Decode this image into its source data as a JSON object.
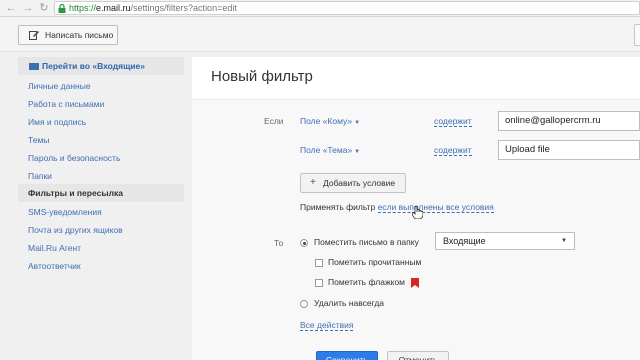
{
  "browser": {
    "url_scheme": "https://",
    "url_host": "e.mail.ru",
    "url_path": "/settings/filters?action=edit",
    "back_icon": "arrow-left-icon",
    "forward_icon": "arrow-right-icon",
    "reload_icon": "reload-icon",
    "lock_icon": "lock-icon"
  },
  "toolbar": {
    "compose_label": "Написать письмо",
    "compose_icon": "pencil-icon"
  },
  "sidebar": {
    "inbox_link": "Перейти во «Входящие»",
    "items": [
      {
        "label": "Личные данные"
      },
      {
        "label": "Работа с письмами"
      },
      {
        "label": "Имя и подпись"
      },
      {
        "label": "Темы"
      },
      {
        "label": "Пароль и безопасность"
      },
      {
        "label": "Папки"
      },
      {
        "label": "Фильтры и пересылка"
      },
      {
        "label": "SMS-уведомления"
      },
      {
        "label": "Почта из других ящиков"
      },
      {
        "label": "Mail.Ru Агент"
      },
      {
        "label": "Автоответчик"
      }
    ],
    "active_index": 6
  },
  "filter": {
    "title": "Новый фильтр",
    "if_label": "Если",
    "conditions": [
      {
        "field": "Поле «Кому»",
        "operator": "содержит",
        "value": "online@gallopercrm.ru"
      },
      {
        "field": "Поле «Тема»",
        "operator": "содержит",
        "value": "Upload file"
      }
    ],
    "add_condition_label": "Добавить условие",
    "apply_prefix": "Применять фильтр",
    "apply_link": "если выполнены все условия",
    "then_label": "То",
    "move_label": "Поместить письмо в папку",
    "folder_value": "Входящие",
    "mark_read_label": "Пометить прочитанным",
    "mark_flag_label": "Пометить флажком",
    "delete_label": "Удалить навсегда",
    "all_actions_label": "Все действия",
    "save_label": "Сохранить",
    "cancel_label": "Отменить"
  },
  "colors": {
    "link": "#3d6fb3",
    "primary_button": "#2b7de9",
    "flag": "#d9261c"
  }
}
